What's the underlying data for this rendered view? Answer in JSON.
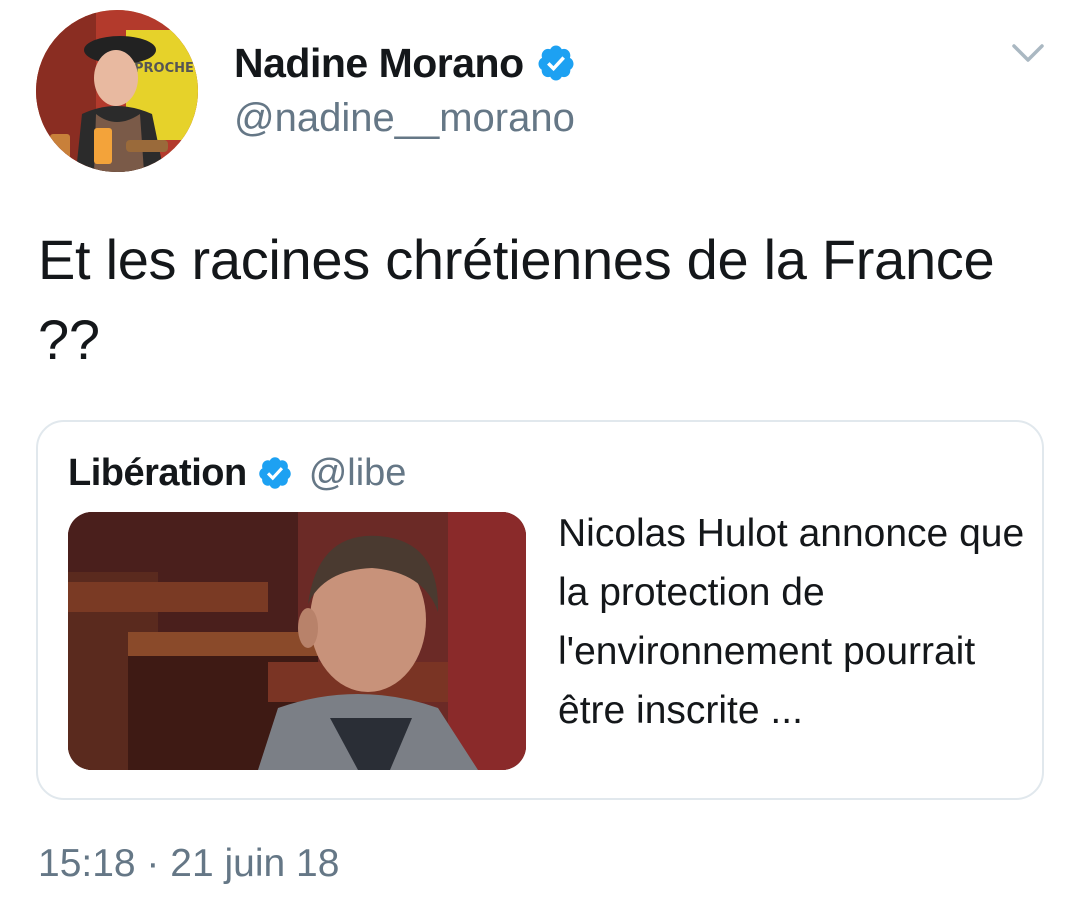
{
  "author": {
    "display_name": "Nadine Morano",
    "handle": "@nadine__morano",
    "avatar_sign_text": "PROCHE"
  },
  "tweet": {
    "text": "Et les racines chrétiennes de la France ??",
    "timestamp": "15:18 · 21 juin 18"
  },
  "quoted": {
    "display_name": "Libération",
    "handle": "@libe",
    "text": "Nicolas Hulot annonce que la protection de l'environnement pourrait être inscrite ..."
  },
  "icons": {
    "verified": "verified-badge-icon",
    "menu": "chevron-down-icon"
  },
  "colors": {
    "verified_blue": "#1da1f2",
    "secondary_text": "#657786",
    "primary_text": "#14171a",
    "border": "#e1e8ed"
  }
}
